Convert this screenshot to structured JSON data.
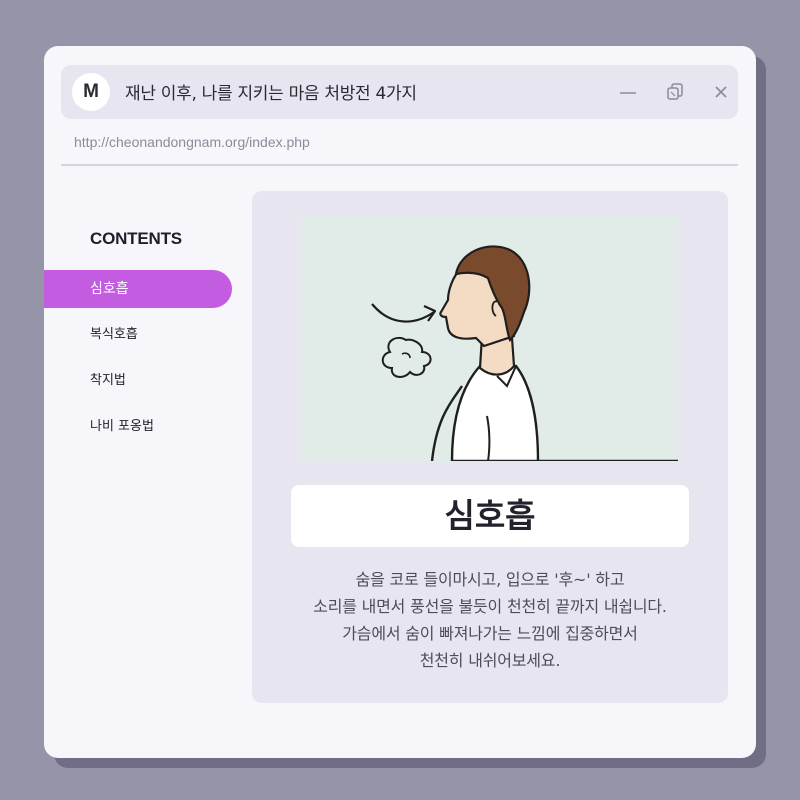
{
  "window": {
    "logo_letter": "M",
    "title": "재난 이후, 나를 지키는 마음 처방전 4가지",
    "url": "http://cheonandongnam.org/index.php"
  },
  "sidebar": {
    "heading": "CONTENTS",
    "items": [
      {
        "label": "심호흡",
        "active": true
      },
      {
        "label": "복식호흡",
        "active": false
      },
      {
        "label": "착지법",
        "active": false
      },
      {
        "label": "나비 포옹법",
        "active": false
      }
    ]
  },
  "main": {
    "illustration_icon": "person-exhaling-illustration",
    "section_title": "심호흡",
    "description": [
      "숨을 코로 들이마시고, 입으로 '후~' 하고",
      "소리를 내면서 풍선을 불듯이 천천히 끝까지 내쉽니다.",
      "가슴에서 숨이 빠져나가는 느낌에 집중하면서",
      "천천히 내쉬어보세요."
    ]
  },
  "colors": {
    "background": "#9594a9",
    "accent": "#c35ce0",
    "panel": "#e7e6f0",
    "illustration_bg": "#e1ebe8"
  },
  "icons": {
    "minimize": "minimize-icon",
    "restore": "restore-icon",
    "close": "close-icon"
  }
}
